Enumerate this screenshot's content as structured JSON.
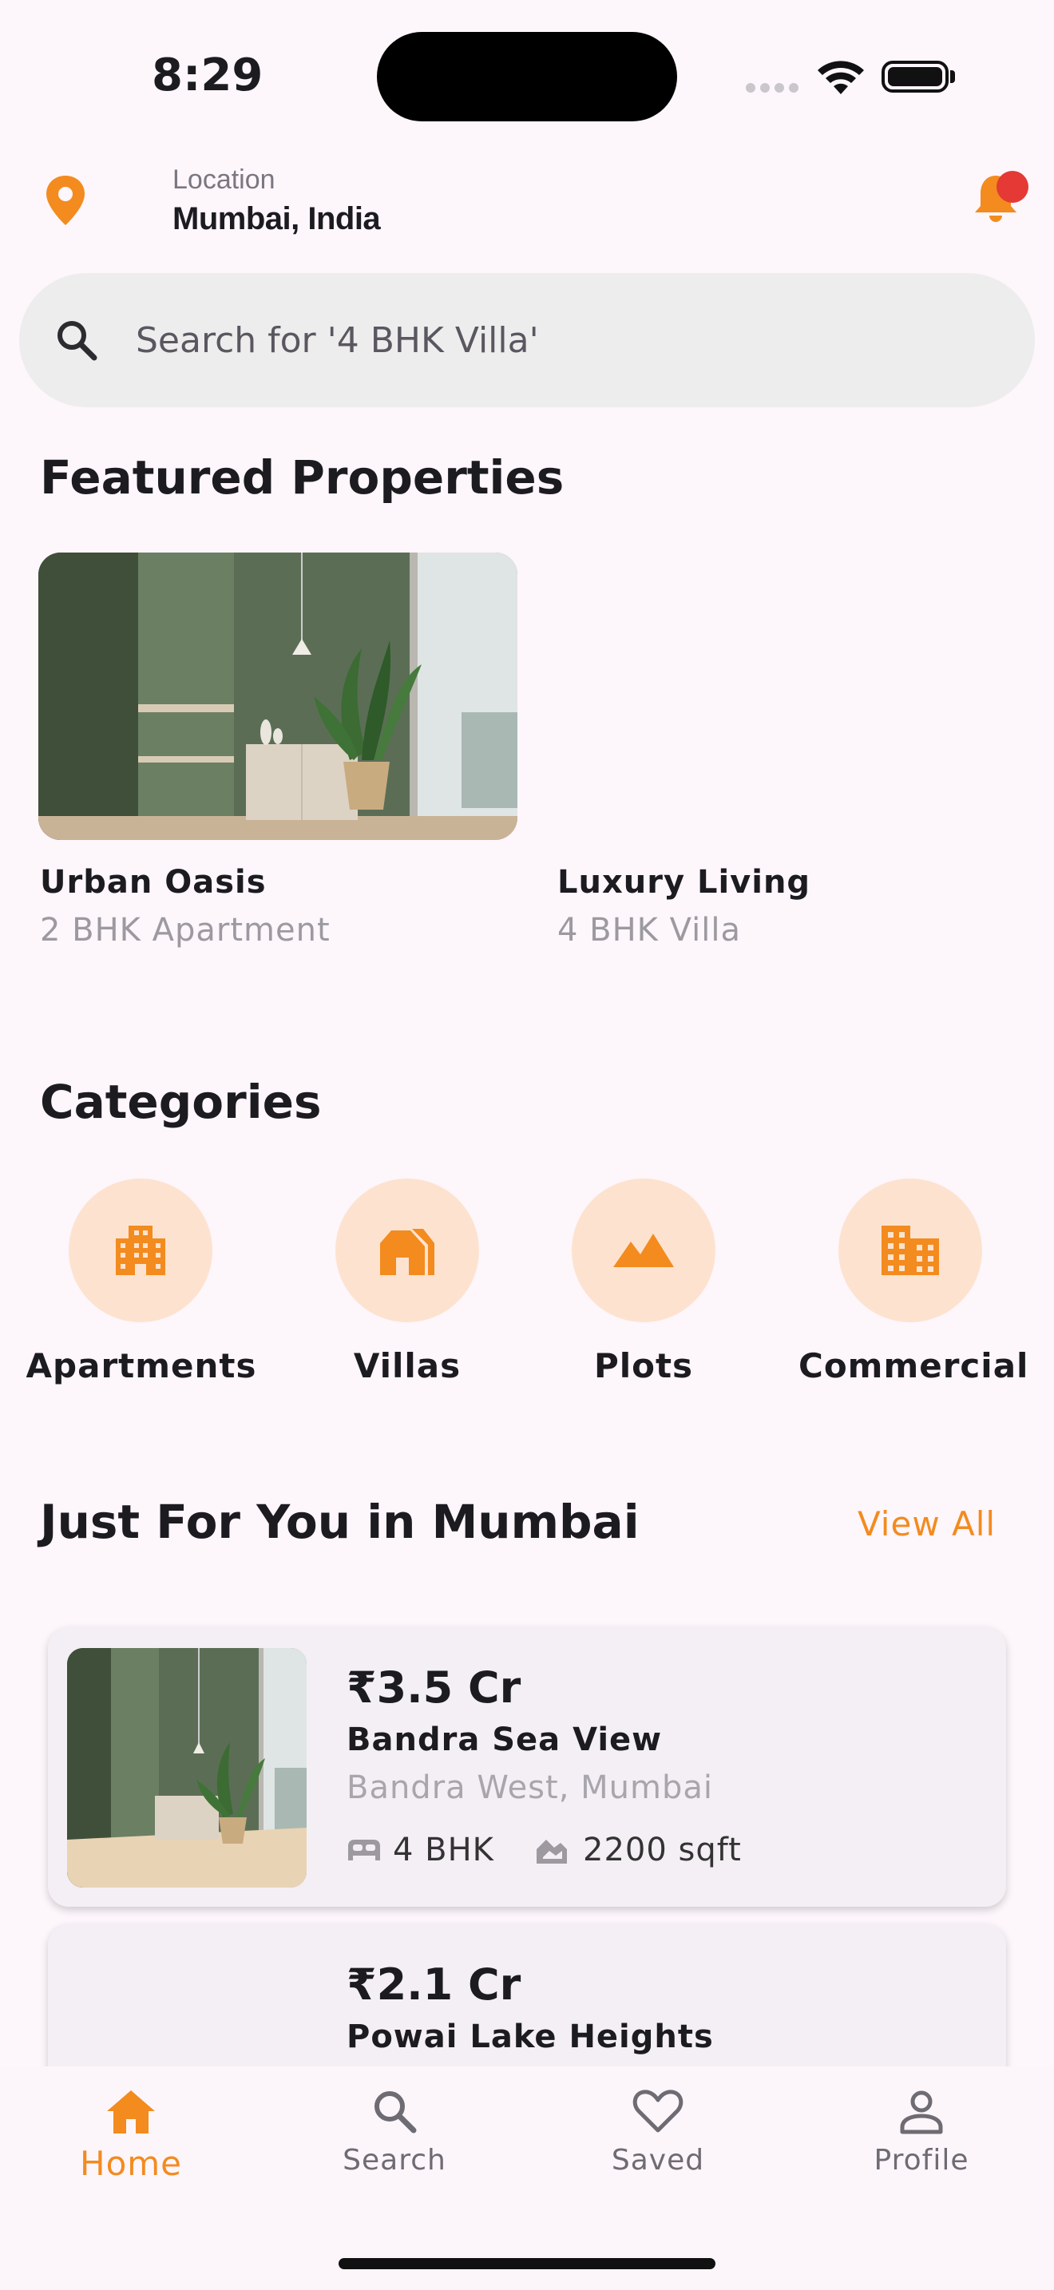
{
  "status_bar": {
    "time": "8:29"
  },
  "header": {
    "location_label": "Location",
    "location_value": "Mumbai, India"
  },
  "search": {
    "placeholder": "Search for '4 BHK Villa'"
  },
  "featured": {
    "title": "Featured Properties",
    "items": [
      {
        "title": "Urban Oasis",
        "subtitle": "2 BHK Apartment"
      },
      {
        "title": "Luxury Living",
        "subtitle": "4 BHK Villa"
      }
    ]
  },
  "categories": {
    "title": "Categories",
    "items": [
      {
        "label": "Apartments",
        "icon": "apartment-icon"
      },
      {
        "label": "Villas",
        "icon": "villa-icon"
      },
      {
        "label": "Plots",
        "icon": "plot-icon"
      },
      {
        "label": "Commercial",
        "icon": "commercial-icon"
      }
    ]
  },
  "just_for_you": {
    "title": "Just For You in Mumbai",
    "view_all": "View All",
    "listings": [
      {
        "price": "₹3.5 Cr",
        "title": "Bandra Sea View",
        "location": "Bandra West, Mumbai",
        "beds": "4 BHK",
        "area": "2200 sqft"
      },
      {
        "price": "₹2.1 Cr",
        "title": "Powai Lake Heights"
      }
    ]
  },
  "bottom_nav": {
    "items": [
      {
        "label": "Home",
        "icon": "home-icon",
        "active": true
      },
      {
        "label": "Search",
        "icon": "search-icon"
      },
      {
        "label": "Saved",
        "icon": "heart-icon"
      },
      {
        "label": "Profile",
        "icon": "person-icon"
      }
    ]
  },
  "colors": {
    "accent": "#f38b1f",
    "category_bg": "#fde3cf",
    "notification_dot": "#e53935",
    "background": "#fdf6fb"
  }
}
